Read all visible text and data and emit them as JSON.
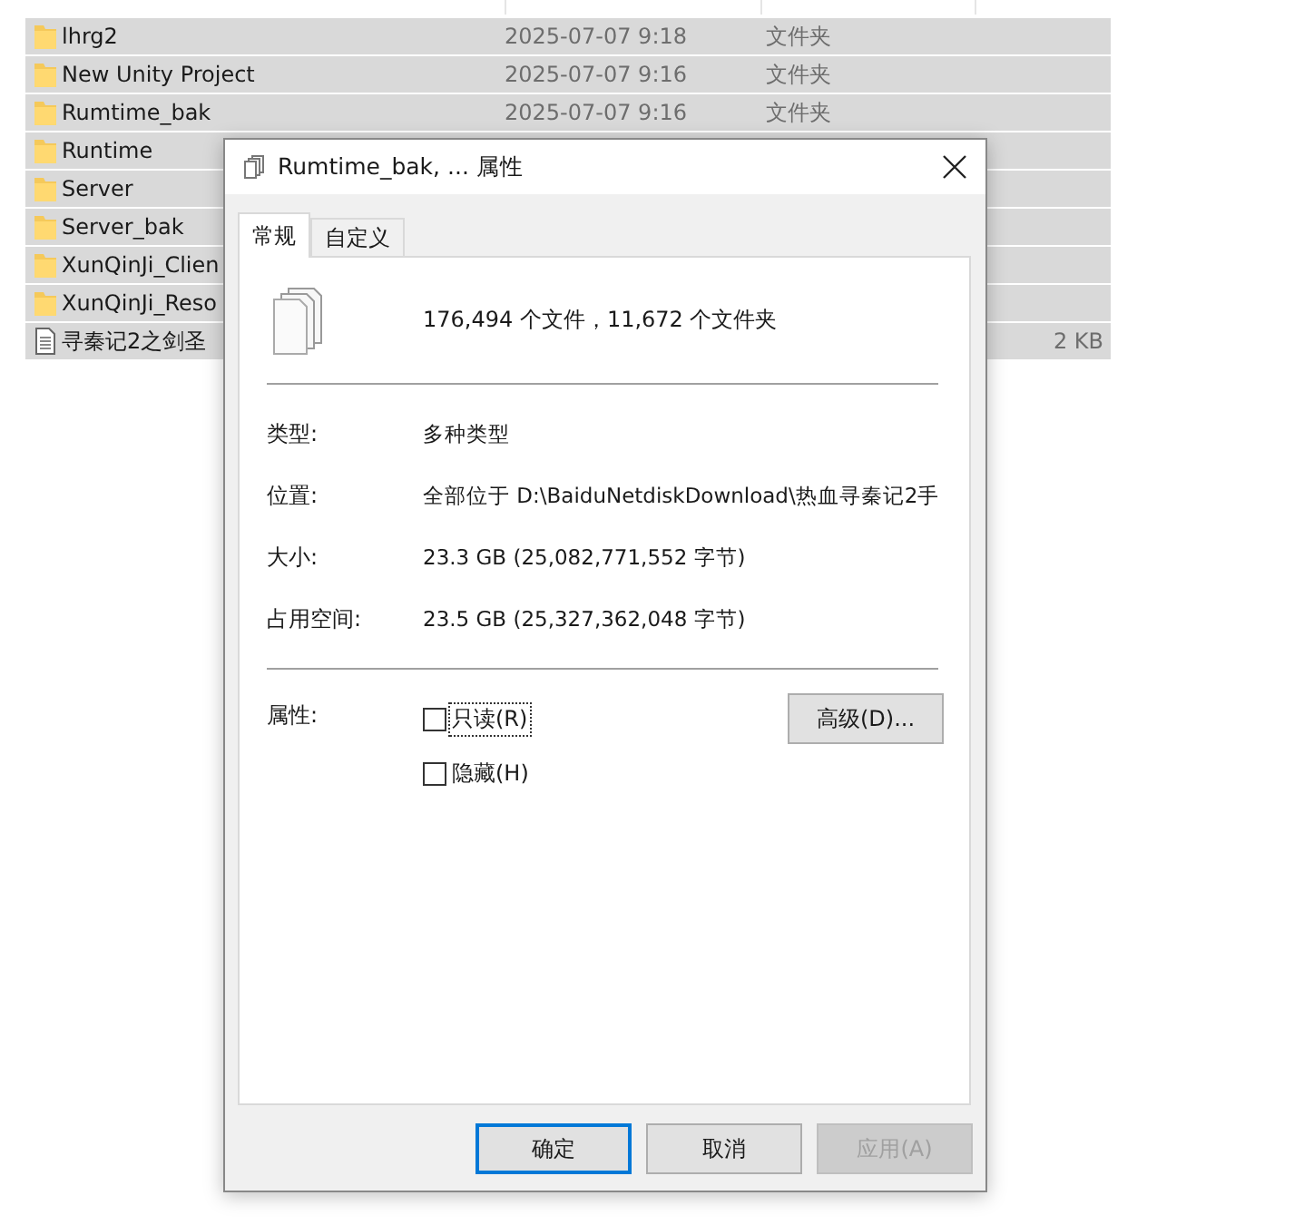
{
  "file_list": {
    "rows": [
      {
        "kind": "folder",
        "name": "lhrg2",
        "date": "2025-07-07 9:18",
        "type": "文件夹",
        "selected": true
      },
      {
        "kind": "folder",
        "name": "New Unity Project",
        "date": "2025-07-07 9:16",
        "type": "文件夹",
        "selected": true
      },
      {
        "kind": "folder",
        "name": "Rumtime_bak",
        "date": "2025-07-07 9:16",
        "type": "文件夹",
        "selected": true
      },
      {
        "kind": "folder",
        "name": "Runtime",
        "selected": true
      },
      {
        "kind": "folder",
        "name": "Server",
        "selected": true
      },
      {
        "kind": "folder",
        "name": "Server_bak",
        "selected": true
      },
      {
        "kind": "folder",
        "name": "XunQinJi_Clien",
        "selected": true
      },
      {
        "kind": "folder",
        "name": "XunQinJi_Reso",
        "selected": true
      },
      {
        "kind": "file",
        "name": "寻秦记2之剑圣",
        "size": "2 KB",
        "selected": true
      }
    ]
  },
  "dialog": {
    "title": "Rumtime_bak, ... 属性",
    "tabs": [
      {
        "label": "常规",
        "selected": true
      },
      {
        "label": "自定义",
        "selected": false
      }
    ],
    "summary": "176,494 个文件，11,672 个文件夹",
    "properties": [
      {
        "label": "类型:",
        "value": "多种类型"
      },
      {
        "label": "位置:",
        "value": "全部位于 D:\\BaiduNetdiskDownload\\热血寻秦记2手"
      },
      {
        "label": "大小:",
        "value": "23.3 GB (25,082,771,552 字节)"
      },
      {
        "label": "占用空间:",
        "value": "23.5 GB (25,327,362,048 字节)"
      }
    ],
    "attributes_label": "属性:",
    "attributes": [
      {
        "label": "只读(R)",
        "checked": false,
        "focused": true
      },
      {
        "label": "隐藏(H)",
        "checked": false,
        "focused": false
      }
    ],
    "advanced_button": "高级(D)...",
    "buttons": [
      {
        "label": "确定",
        "kind": "default",
        "disabled": false
      },
      {
        "label": "取消",
        "kind": "normal",
        "disabled": false
      },
      {
        "label": "应用(A)",
        "kind": "normal",
        "disabled": true
      }
    ]
  }
}
